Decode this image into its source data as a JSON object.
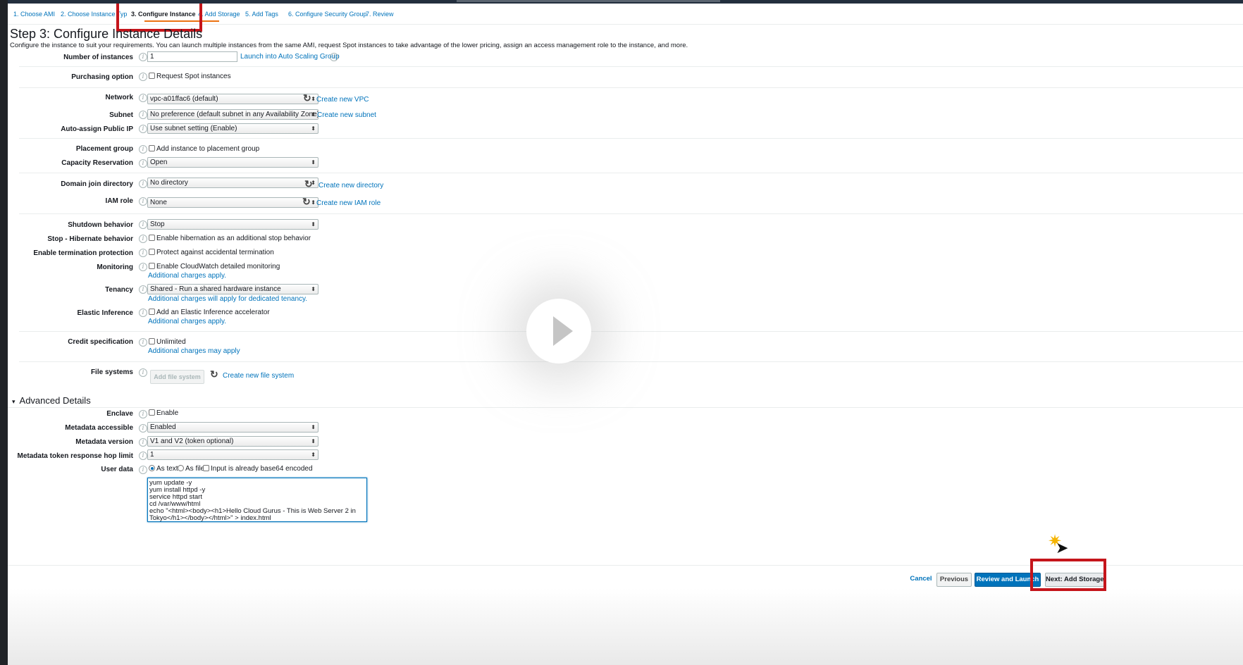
{
  "tabs": [
    {
      "label": "1. Choose AMI"
    },
    {
      "label": "2. Choose Instance Typ"
    },
    {
      "label": "3. Configure Instance"
    },
    {
      "label": "4. Add Storage"
    },
    {
      "label": "5. Add Tags"
    },
    {
      "label": "6. Configure Security Group"
    },
    {
      "label": "7. Review"
    }
  ],
  "page": {
    "title": "Step 3: Configure Instance Details",
    "subtitle": "Configure the instance to suit your requirements. You can launch multiple instances from the same AMI, request Spot instances to take advantage of the lower pricing, assign an access management role to the instance, and more."
  },
  "info_glyph": "i",
  "refresh_glyph": "↻",
  "caret_glyph": "▾",
  "select_arrow_glyph": "⬍",
  "fields": {
    "number_of_instances": {
      "label": "Number of instances",
      "value": "1",
      "link": "Launch into Auto Scaling Group"
    },
    "purchasing_option": {
      "label": "Purchasing option",
      "checkbox": "Request Spot instances"
    },
    "network": {
      "label": "Network",
      "value": "vpc-a01ffac6 (default)",
      "link": "Create new VPC"
    },
    "subnet": {
      "label": "Subnet",
      "value": "No preference (default subnet in any Availability Zone)",
      "link": "Create new subnet"
    },
    "auto_assign_ip": {
      "label": "Auto-assign Public IP",
      "value": "Use subnet setting (Enable)"
    },
    "placement_group": {
      "label": "Placement group",
      "checkbox": "Add instance to placement group"
    },
    "capacity_reservation": {
      "label": "Capacity Reservation",
      "value": "Open"
    },
    "domain_join": {
      "label": "Domain join directory",
      "value": "No directory",
      "link": "Create new directory"
    },
    "iam_role": {
      "label": "IAM role",
      "value": "None",
      "link": "Create new IAM role"
    },
    "shutdown_behavior": {
      "label": "Shutdown behavior",
      "value": "Stop"
    },
    "stop_hibernate": {
      "label": "Stop - Hibernate behavior",
      "checkbox": "Enable hibernation as an additional stop behavior"
    },
    "termination_protection": {
      "label": "Enable termination protection",
      "checkbox": "Protect against accidental termination"
    },
    "monitoring": {
      "label": "Monitoring",
      "checkbox": "Enable CloudWatch detailed monitoring",
      "note": "Additional charges apply."
    },
    "tenancy": {
      "label": "Tenancy",
      "value": "Shared - Run a shared hardware instance",
      "note": "Additional charges will apply for dedicated tenancy."
    },
    "elastic_inference": {
      "label": "Elastic Inference",
      "checkbox": "Add an Elastic Inference accelerator",
      "note": "Additional charges apply."
    },
    "credit_specification": {
      "label": "Credit specification",
      "checkbox": "Unlimited",
      "note": "Additional charges may apply"
    },
    "file_systems": {
      "label": "File systems",
      "button": "Add file system",
      "link": "Create new file system"
    }
  },
  "advanced": {
    "title": "Advanced Details",
    "enclave": {
      "label": "Enclave",
      "checkbox": "Enable"
    },
    "metadata_accessible": {
      "label": "Metadata accessible",
      "value": "Enabled"
    },
    "metadata_version": {
      "label": "Metadata version",
      "value": "V1 and V2 (token optional)"
    },
    "hop_limit": {
      "label": "Metadata token response hop limit",
      "value": "1"
    },
    "user_data": {
      "label": "User data",
      "as_text": "As text",
      "as_file": "As file",
      "base64": "Input is already base64 encoded",
      "script": "yum update -y\nyum install httpd -y\nservice httpd start\ncd /var/www/html\necho \"<html><body><h1>Hello Cloud Gurus - This is Web Server 2 in\nTokyo</h1></body></html>\" > index.html"
    }
  },
  "footer": {
    "cancel": "Cancel",
    "previous": "Previous",
    "review": "Review and Launch",
    "next": "Next: Add Storage"
  }
}
